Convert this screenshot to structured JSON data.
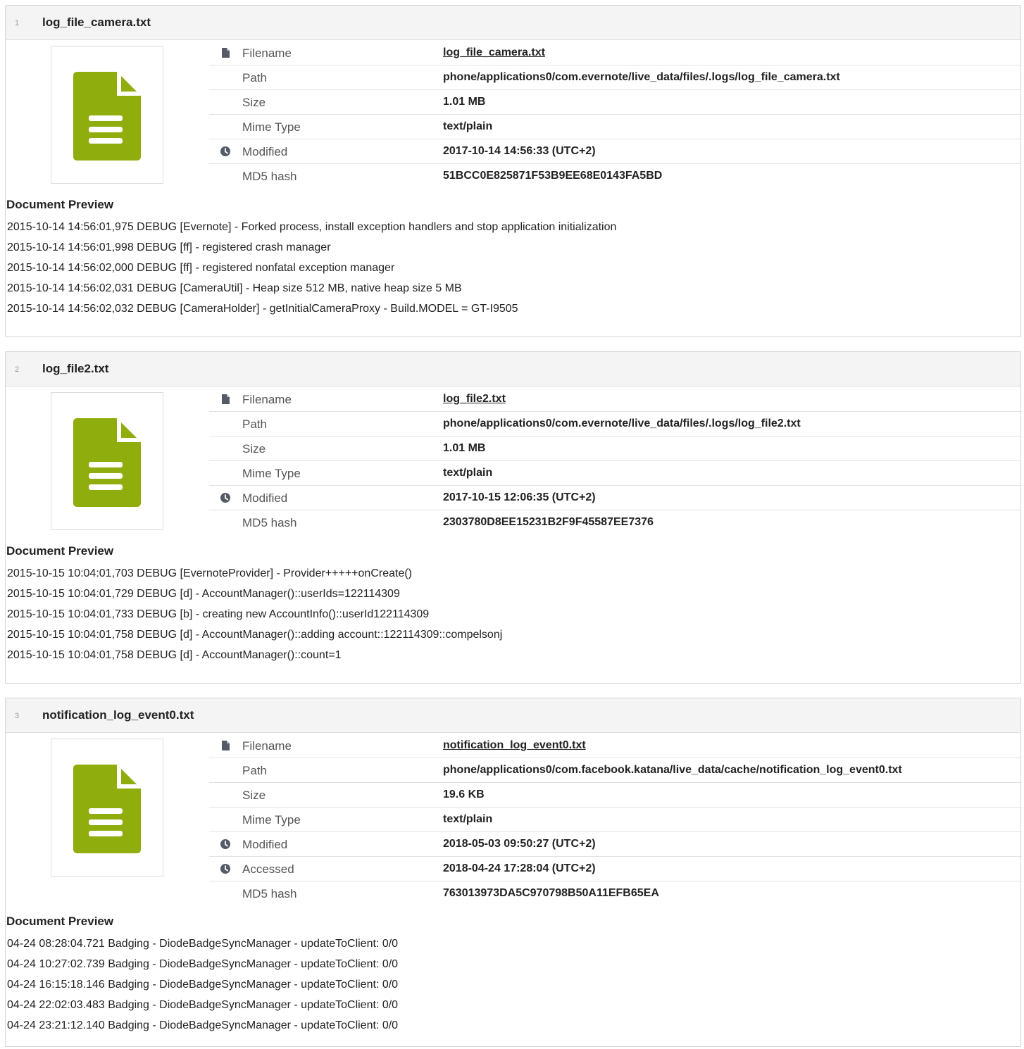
{
  "results": [
    {
      "number": "1",
      "title": "log_file_camera.txt",
      "properties": [
        {
          "label": "Filename",
          "value": "log_file_camera.txt",
          "icon": "file-icon",
          "link": true
        },
        {
          "label": "Path",
          "value": "phone/applications0/com.evernote/live_data/files/.logs/log_file_camera.txt",
          "icon": "",
          "link": false
        },
        {
          "label": "Size",
          "value": "1.01 MB",
          "icon": "",
          "link": false
        },
        {
          "label": "Mime Type",
          "value": "text/plain",
          "icon": "",
          "link": false
        },
        {
          "label": "Modified",
          "value": "2017-10-14 14:56:33 (UTC+2)",
          "icon": "clock-icon",
          "link": false
        },
        {
          "label": "MD5 hash",
          "value": "51BCC0E825871F53B9EE68E0143FA5BD",
          "icon": "",
          "link": false
        }
      ],
      "preview_title": "Document Preview",
      "preview_lines": [
        "2015-10-14 14:56:01,975 DEBUG [Evernote] - Forked process, install exception handlers and stop application initialization",
        "2015-10-14 14:56:01,998 DEBUG [ff] - registered crash manager",
        "2015-10-14 14:56:02,000 DEBUG [ff] - registered nonfatal exception manager",
        "2015-10-14 14:56:02,031 DEBUG [CameraUtil] - Heap size 512 MB, native heap size 5 MB",
        "2015-10-14 14:56:02,032 DEBUG [CameraHolder] - getInitialCameraProxy - Build.MODEL = GT-I9505"
      ]
    },
    {
      "number": "2",
      "title": "log_file2.txt",
      "properties": [
        {
          "label": "Filename",
          "value": "log_file2.txt",
          "icon": "file-icon",
          "link": true
        },
        {
          "label": "Path",
          "value": "phone/applications0/com.evernote/live_data/files/.logs/log_file2.txt",
          "icon": "",
          "link": false
        },
        {
          "label": "Size",
          "value": "1.01 MB",
          "icon": "",
          "link": false
        },
        {
          "label": "Mime Type",
          "value": "text/plain",
          "icon": "",
          "link": false
        },
        {
          "label": "Modified",
          "value": "2017-10-15 12:06:35 (UTC+2)",
          "icon": "clock-icon",
          "link": false
        },
        {
          "label": "MD5 hash",
          "value": "2303780D8EE15231B2F9F45587EE7376",
          "icon": "",
          "link": false
        }
      ],
      "preview_title": "Document Preview",
      "preview_lines": [
        "2015-10-15 10:04:01,703 DEBUG [EvernoteProvider] - Provider+++++onCreate()",
        "2015-10-15 10:04:01,729 DEBUG [d] - AccountManager()::userIds=122114309",
        "2015-10-15 10:04:01,733 DEBUG [b] - creating new AccountInfo()::userId122114309",
        "2015-10-15 10:04:01,758 DEBUG [d] - AccountManager()::adding account::122114309::compelsonj",
        "2015-10-15 10:04:01,758 DEBUG [d] - AccountManager()::count=1"
      ]
    },
    {
      "number": "3",
      "title": "notification_log_event0.txt",
      "properties": [
        {
          "label": "Filename",
          "value": "notification_log_event0.txt",
          "icon": "file-icon",
          "link": true
        },
        {
          "label": "Path",
          "value": "phone/applications0/com.facebook.katana/live_data/cache/notification_log_event0.txt",
          "icon": "",
          "link": false
        },
        {
          "label": "Size",
          "value": "19.6 KB",
          "icon": "",
          "link": false
        },
        {
          "label": "Mime Type",
          "value": "text/plain",
          "icon": "",
          "link": false
        },
        {
          "label": "Modified",
          "value": "2018-05-03 09:50:27 (UTC+2)",
          "icon": "clock-icon",
          "link": false
        },
        {
          "label": "Accessed",
          "value": "2018-04-24 17:28:04 (UTC+2)",
          "icon": "clock-icon",
          "link": false
        },
        {
          "label": "MD5 hash",
          "value": "763013973DA5C970798B50A11EFB65EA",
          "icon": "",
          "link": false
        }
      ],
      "preview_title": "Document Preview",
      "preview_lines": [
        "04-24 08:28:04.721 Badging - DiodeBadgeSyncManager - updateToClient: 0/0",
        "04-24 10:27:02.739 Badging - DiodeBadgeSyncManager - updateToClient: 0/0",
        "04-24 16:15:18.146 Badging - DiodeBadgeSyncManager - updateToClient: 0/0",
        "04-24 22:02:03.483 Badging - DiodeBadgeSyncManager - updateToClient: 0/0",
        "04-24 23:21:12.140 Badging - DiodeBadgeSyncManager - updateToClient: 0/0"
      ]
    }
  ],
  "colors": {
    "document_icon": "#8fad0c",
    "property_icon": "#555b66",
    "header_background": "#f4f4f4"
  }
}
